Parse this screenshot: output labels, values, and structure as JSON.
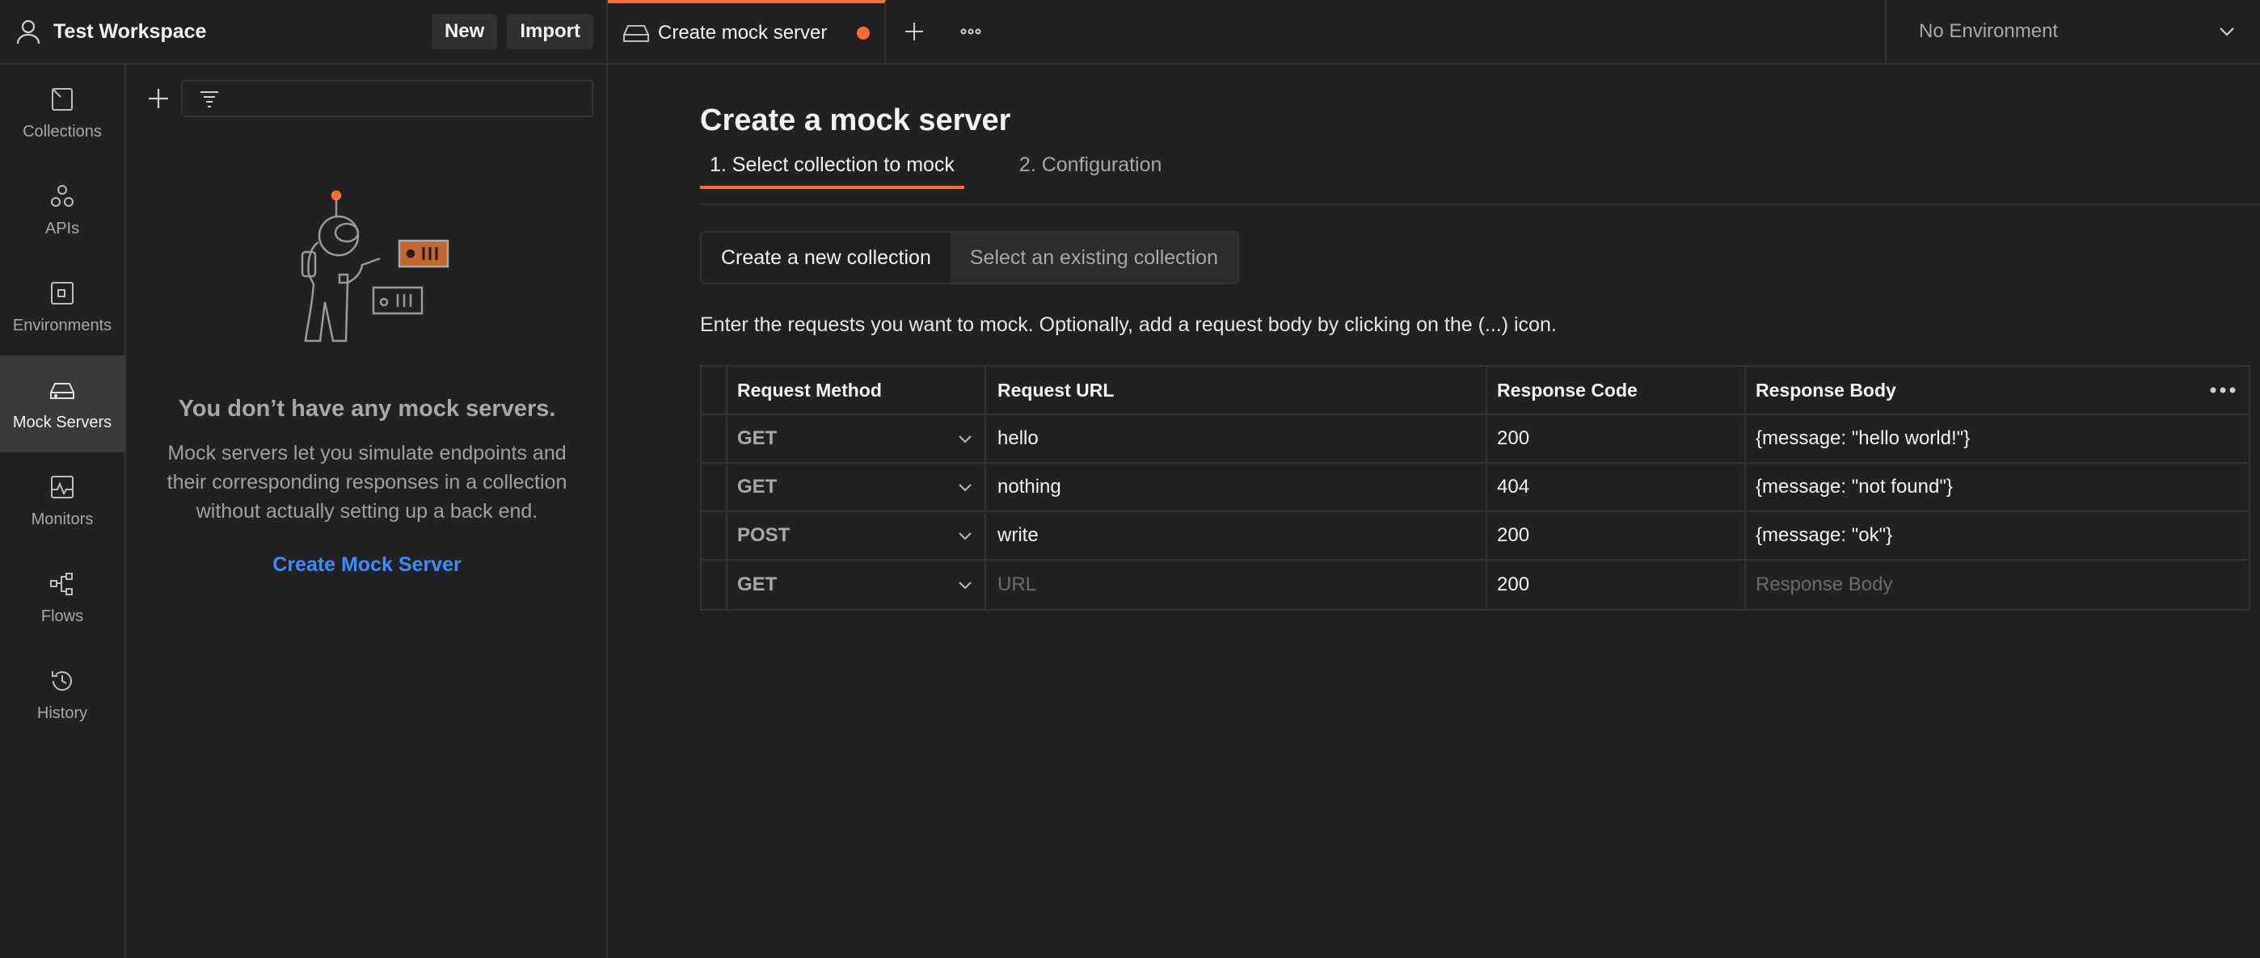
{
  "workspace": {
    "title": "Test Workspace",
    "new_label": "New",
    "import_label": "Import"
  },
  "sidebar": {
    "items": [
      {
        "label": "Collections",
        "icon": "collections-icon"
      },
      {
        "label": "APIs",
        "icon": "apis-icon"
      },
      {
        "label": "Environments",
        "icon": "environments-icon"
      },
      {
        "label": "Mock Servers",
        "icon": "mock-servers-icon",
        "active": true
      },
      {
        "label": "Monitors",
        "icon": "monitors-icon"
      },
      {
        "label": "Flows",
        "icon": "flows-icon"
      },
      {
        "label": "History",
        "icon": "history-icon"
      }
    ]
  },
  "empty_state": {
    "title": "You don’t have any mock servers.",
    "description": "Mock servers let you simulate endpoints and their corresponding responses in a collection without actually setting up a back end.",
    "link": "Create Mock Server"
  },
  "tabs": [
    {
      "label": "Create mock server",
      "unsaved": true
    }
  ],
  "environment": {
    "selected": "No Environment"
  },
  "main": {
    "title": "Create a mock server",
    "steps": [
      {
        "label": "1.  Select collection to mock",
        "active": true
      },
      {
        "label": "2.  Configuration",
        "active": false
      }
    ],
    "segments": [
      {
        "label": "Create a new collection",
        "active": true
      },
      {
        "label": "Select an existing collection",
        "active": false
      }
    ],
    "hint": "Enter the requests you want to mock. Optionally, add a request body by clicking on the (...) icon.",
    "table": {
      "headers": [
        "Request Method",
        "Request URL",
        "Response Code",
        "Response Body"
      ],
      "rows": [
        {
          "method": "GET",
          "url": "hello",
          "code": "200",
          "body": "{message: \"hello world!\"}"
        },
        {
          "method": "GET",
          "url": "nothing",
          "code": "404",
          "body": "{message: \"not found\"}"
        },
        {
          "method": "POST",
          "url": "write",
          "code": "200",
          "body": "{message: \"ok\"}"
        },
        {
          "method": "GET",
          "url": "",
          "code": "200",
          "body": ""
        }
      ],
      "url_placeholder": "URL",
      "body_placeholder": "Response Body"
    }
  },
  "colors": {
    "accent": "#ff6c37",
    "link": "#3d8cff",
    "background": "#212121"
  }
}
